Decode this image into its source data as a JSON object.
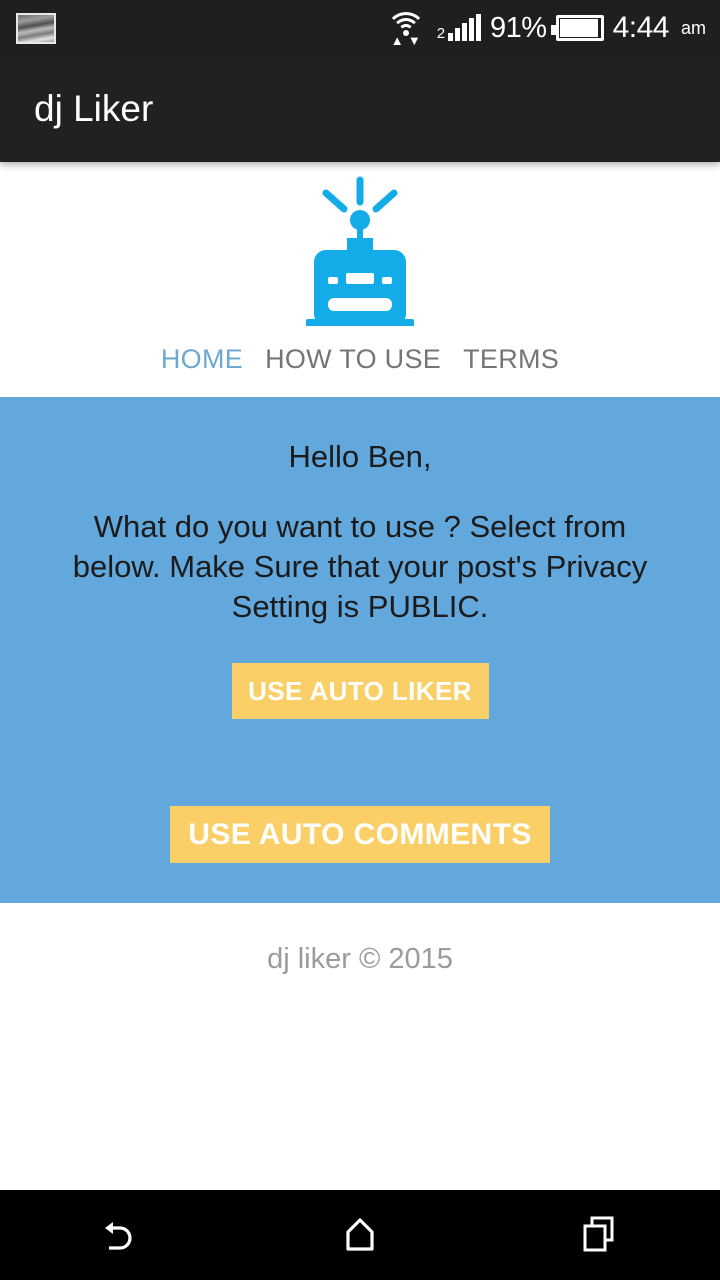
{
  "status_bar": {
    "notification_icon": "screenshot-image-icon",
    "wifi_icon": "wifi-with-transfer-arrows-icon",
    "signal_icon": "cellular-signal-icon",
    "sim_label": "2",
    "battery_percent": "91%",
    "battery_icon": "battery-icon",
    "time": "4:44",
    "am_pm": "am"
  },
  "app_bar": {
    "title": "dj Liker"
  },
  "logo": {
    "icon_name": "robot-head-logo",
    "color": "#14ace8"
  },
  "tabs": [
    {
      "label": "HOME",
      "active": true
    },
    {
      "label": "HOW TO USE",
      "active": false
    },
    {
      "label": "TERMS",
      "active": false
    }
  ],
  "hero": {
    "background_color": "#62a8dd",
    "greeting": "Hello Ben,",
    "blurb": "What do you want to use ? Select from below. Make Sure that your post's Privacy Setting is PUBLIC.",
    "button_color": "#fbcf68",
    "buttons": [
      {
        "label": "USE AUTO LIKER"
      },
      {
        "label": "USE AUTO COMMENTS"
      }
    ]
  },
  "footer": {
    "text": "dj liker © 2015"
  },
  "nav_bar": {
    "back": "back-icon",
    "home": "home-icon",
    "recents": "recents-icon"
  }
}
